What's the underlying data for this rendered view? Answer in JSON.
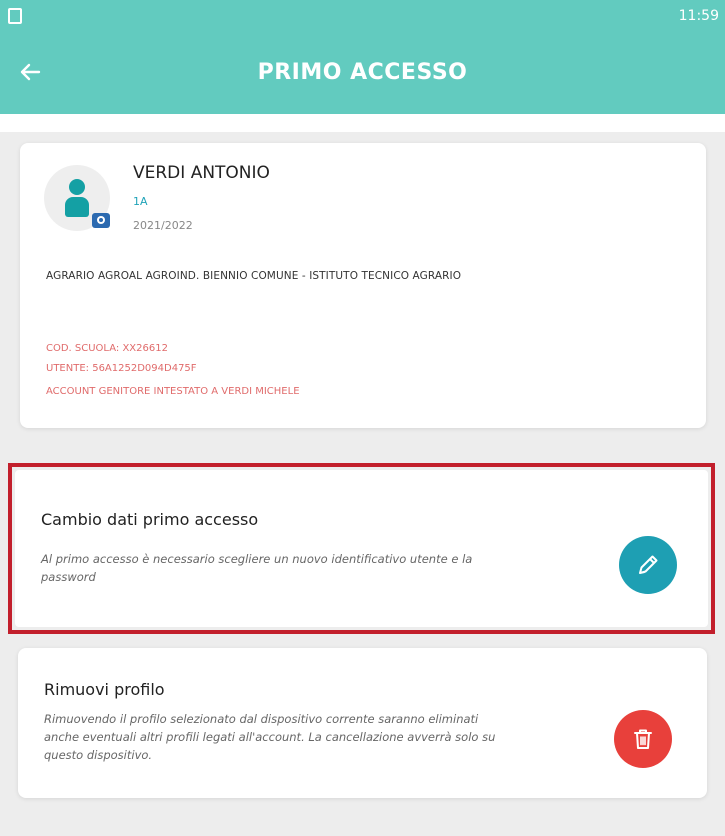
{
  "status_bar": {
    "time": "11:59"
  },
  "header": {
    "title": "PRIMO ACCESSO"
  },
  "profile": {
    "name": "VERDI ANTONIO",
    "class": "1A",
    "school_year": "2021/2022",
    "school": "AGRARIO AGROAL AGROIND. BIENNIO COMUNE - ISTITUTO TECNICO AGRARIO",
    "school_code": "COD. SCUOLA: XX26612",
    "user_code": "UTENTE: 56A1252D094D475F",
    "account_owner": "ACCOUNT GENITORE INTESTATO A VERDI MICHELE"
  },
  "change_access": {
    "title": "Cambio dati primo accesso",
    "description": "Al primo accesso è necessario scegliere un nuovo identificativo utente e la password"
  },
  "remove_profile": {
    "title": "Rimuovi profilo",
    "description": "Rimuovendo il profilo selezionato dal dispositivo corrente saranno eliminati anche eventuali altri profili legati all'account. La cancellazione avverrà solo su questo dispositivo."
  },
  "icons": {
    "back": "arrow-left-icon",
    "avatar": "user-icon",
    "camera": "camera-icon",
    "edit": "pencil-icon",
    "delete": "trash-icon",
    "app": "app-notification-icon"
  },
  "colors": {
    "header": "#62cbbf",
    "accent_teal": "#1e9fb3",
    "delete_red": "#e8403b",
    "highlight_frame": "#c21f2c",
    "info_red": "#e06b6b"
  }
}
